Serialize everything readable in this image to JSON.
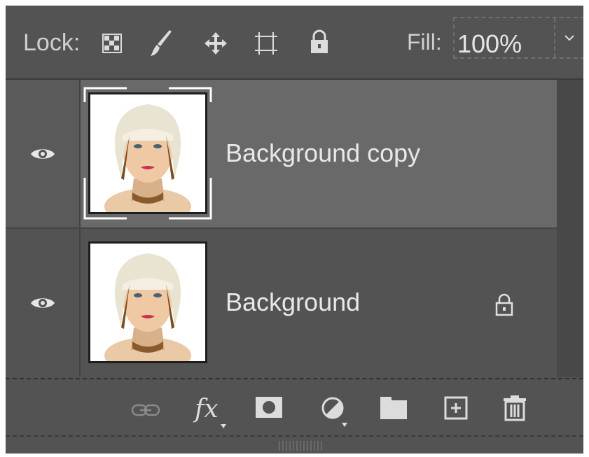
{
  "lock": {
    "label": "Lock:",
    "icons": [
      "lock-transparent-pixels-icon",
      "lock-image-pixels-icon",
      "lock-position-icon",
      "lock-artboard-icon",
      "lock-all-icon"
    ]
  },
  "fill": {
    "label": "Fill:",
    "value": "100%"
  },
  "layers": [
    {
      "name": "Background copy",
      "selected": true,
      "visible": true,
      "locked": false
    },
    {
      "name": "Background",
      "selected": false,
      "visible": true,
      "locked": true
    }
  ],
  "bottom_icons": [
    "link-layers-icon",
    "fx-icon",
    "layer-mask-icon",
    "adjustment-layer-icon",
    "group-folder-icon",
    "new-layer-icon",
    "trash-icon"
  ],
  "bottom": {
    "fx_label": "fx"
  },
  "colors": {
    "panel_bg": "#535353",
    "selected_layer_bg": "#696969",
    "text": "#e8e8e8"
  }
}
